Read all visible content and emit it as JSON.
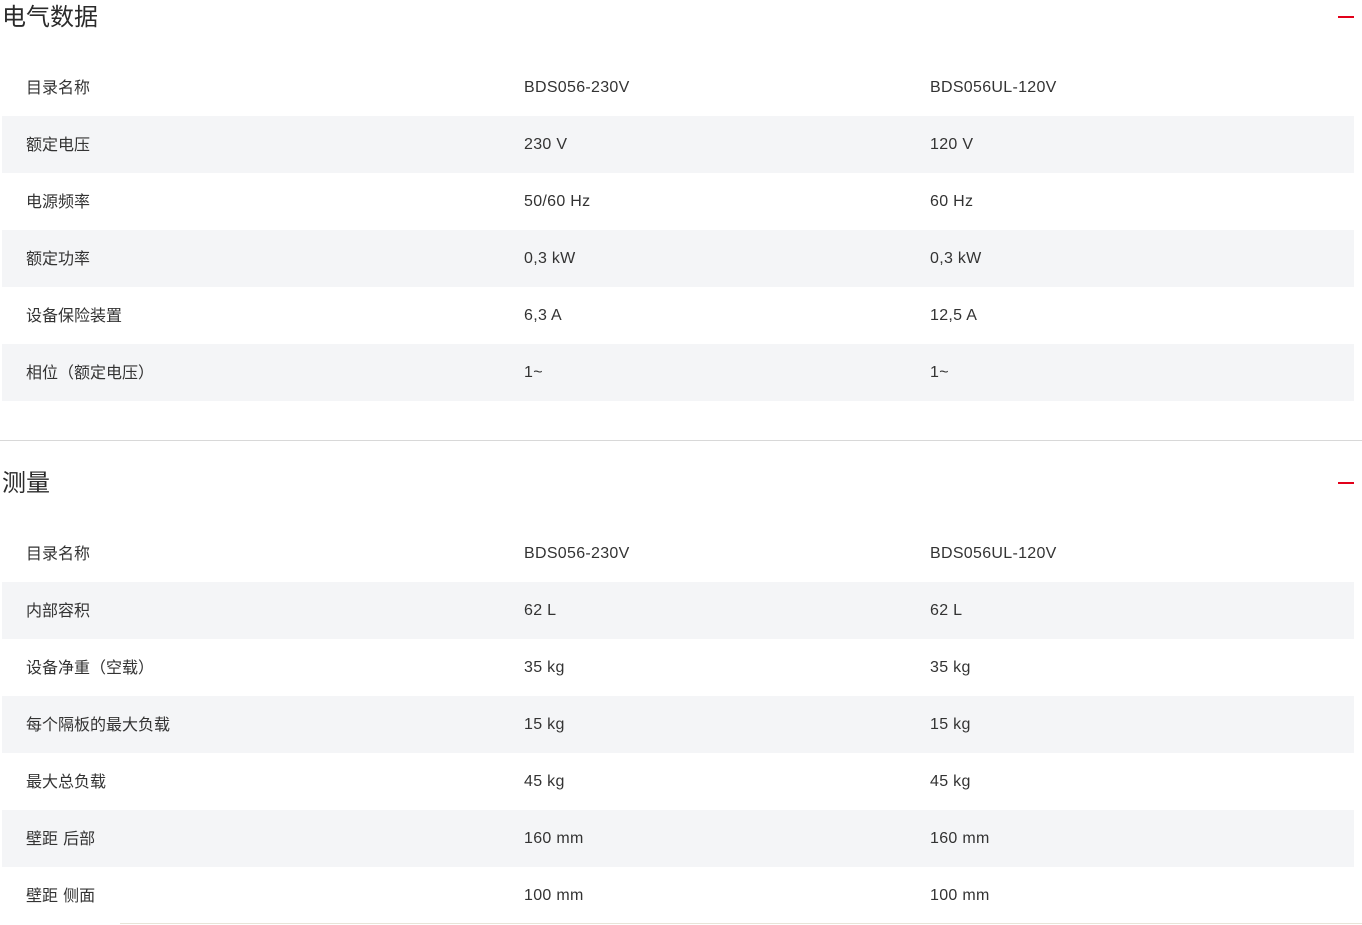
{
  "sections": [
    {
      "title": "电气数据",
      "rows": [
        {
          "label": "目录名称",
          "v1": "BDS056-230V",
          "v2": "BDS056UL-120V"
        },
        {
          "label": "额定电压",
          "v1": "230 V",
          "v2": "120 V"
        },
        {
          "label": "电源频率",
          "v1": "50/60 Hz",
          "v2": "60 Hz"
        },
        {
          "label": "额定功率",
          "v1": "0,3 kW",
          "v2": "0,3 kW"
        },
        {
          "label": "设备保险装置",
          "v1": "6,3 A",
          "v2": "12,5 A"
        },
        {
          "label": "相位（额定电压）",
          "v1": "1~",
          "v2": "1~"
        }
      ]
    },
    {
      "title": "测量",
      "rows": [
        {
          "label": "目录名称",
          "v1": "BDS056-230V",
          "v2": "BDS056UL-120V"
        },
        {
          "label": "内部容积",
          "v1": "62 L",
          "v2": "62 L"
        },
        {
          "label": "设备净重（空载）",
          "v1": "35 kg",
          "v2": "35 kg"
        },
        {
          "label": "每个隔板的最大负载",
          "v1": "15 kg",
          "v2": "15 kg"
        },
        {
          "label": "最大总负载",
          "v1": "45 kg",
          "v2": "45 kg"
        },
        {
          "label": "壁距 后部",
          "v1": "160 mm",
          "v2": "160 mm"
        },
        {
          "label": "壁距 侧面",
          "v1": "100 mm",
          "v2": "100 mm"
        }
      ]
    }
  ],
  "colors": {
    "accent": "#e2001a",
    "row_alt_bg": "#f4f5f7",
    "text": "#333333",
    "divider": "#d8d8d8"
  },
  "icons": {
    "collapse": "minus-icon"
  }
}
